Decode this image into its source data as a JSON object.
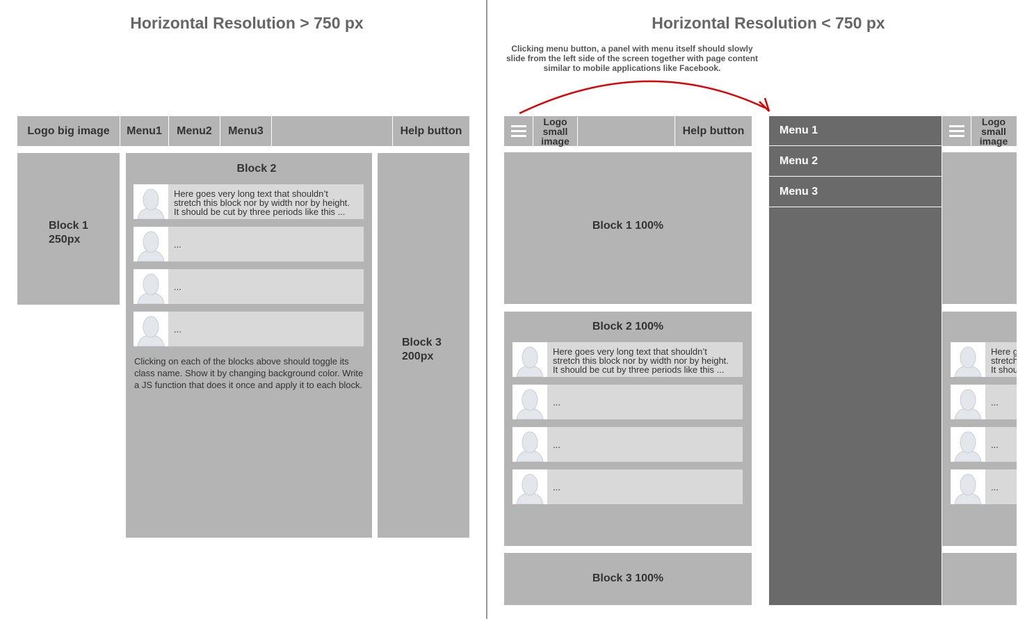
{
  "left": {
    "heading": "Horizontal Resolution > 750 px",
    "header": {
      "logo": "Logo big image",
      "menu1": "Menu1",
      "menu2": "Menu2",
      "menu3": "Menu3",
      "help": "Help button"
    },
    "block1": {
      "title": "Block 1",
      "size": "250px"
    },
    "block2": {
      "title": "Block 2",
      "posts": [
        {
          "lines": [
            "Here goes very long text that shouldn’t",
            "stretch this block nor by width nor by height.",
            "It should be cut by three periods like this ..."
          ]
        },
        {
          "text": "..."
        },
        {
          "text": "..."
        },
        {
          "text": "..."
        }
      ],
      "note": "Clicking on each of the blocks above should toggle its class name. Show it by changing background color. Write a JS function that does it once and apply it to each block."
    },
    "block3": {
      "title": "Block 3",
      "size": "200px"
    }
  },
  "right": {
    "heading": "Horizontal Resolution < 750 px",
    "note": "Clicking menu button, a panel with menu itself should slowly slide from the left side of the screen together with page content similar to mobile applications like Facebook.",
    "header": {
      "logo": "Logo small image",
      "help": "Help button"
    },
    "block1": "Block 1 100%",
    "block2": {
      "title": "Block 2 100%",
      "posts": [
        {
          "lines": [
            "Here goes very long text that shouldn’t",
            "stretch this block nor by width nor by height.",
            "It should be cut by three periods like this ..."
          ]
        },
        {
          "text": "..."
        },
        {
          "text": "..."
        },
        {
          "text": "..."
        }
      ]
    },
    "block3": "Block 3 100%",
    "panel": {
      "items": [
        "Menu 1",
        "Menu 2",
        "Menu 3"
      ]
    },
    "slid": {
      "logo": "Logo small image",
      "posts": [
        {
          "lines": [
            "Here goes very long text that shouldn’t",
            "stretch this block nor by width nor by height.",
            "It should be cut by three periods like this ..."
          ]
        },
        {
          "text": "..."
        },
        {
          "text": "..."
        },
        {
          "text": "..."
        }
      ]
    }
  },
  "colors": {
    "block": "#b4b4b4",
    "post": "#d9d9d9",
    "panel": "#6a6a6a",
    "arrow": "#dd0000",
    "divider": "#999999"
  }
}
